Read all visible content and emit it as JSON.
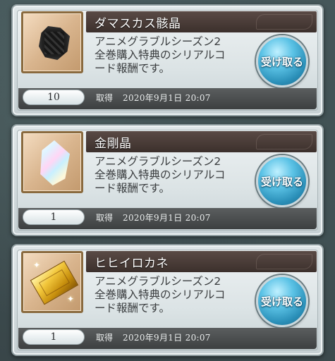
{
  "items": [
    {
      "name": "ダマスカス骸晶",
      "icon": "damascus-crystal-icon",
      "description_lines": [
        "アニメグラブルシーズン2",
        "全巻購入特典のシリアルコ",
        "ード報酬です。"
      ],
      "claim_label": "受け取る",
      "quantity": "10",
      "acquired_label": "取得",
      "acquired_date": "2020年9月1日 20:07"
    },
    {
      "name": "金剛晶",
      "icon": "adamantite-crystal-icon",
      "description_lines": [
        "アニメグラブルシーズン2",
        "全巻購入特典のシリアルコ",
        "ード報酬です。"
      ],
      "claim_label": "受け取る",
      "quantity": "1",
      "acquired_label": "取得",
      "acquired_date": "2020年9月1日 20:07"
    },
    {
      "name": "ヒヒイロカネ",
      "icon": "hihiirokane-gold-icon",
      "description_lines": [
        "アニメグラブルシーズン2",
        "全巻購入特典のシリアルコ",
        "ード報酬です。"
      ],
      "claim_label": "受け取る",
      "quantity": "1",
      "acquired_label": "取得",
      "acquired_date": "2020年9月1日 20:07"
    }
  ]
}
